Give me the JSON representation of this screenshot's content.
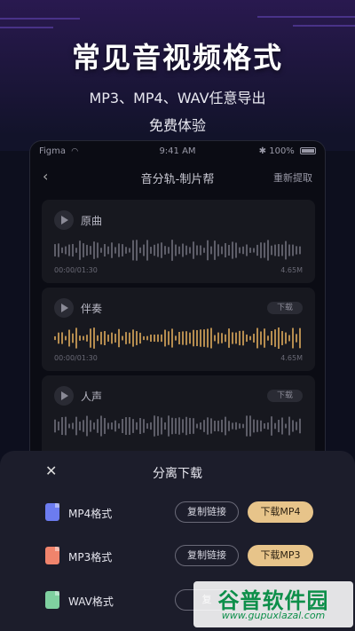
{
  "promo": {
    "headline": "常见音视频格式",
    "subline1": "MP3、MP4、WAV任意导出",
    "subline2": "免费体验"
  },
  "status_bar": {
    "carrier": "Figma",
    "time": "9:41 AM",
    "battery": "100%"
  },
  "nav": {
    "back_icon": "chevron-left-icon",
    "title": "音分轨-制片帮",
    "action": "重新提取"
  },
  "tracks": [
    {
      "name": "原曲",
      "download": "",
      "time": "00:00/01:30",
      "size": "4.65M",
      "wave_color": "#5d5d68"
    },
    {
      "name": "伴奏",
      "download": "下载",
      "time": "00:00/01:30",
      "size": "4.65M",
      "wave_color": "#b58c4f"
    },
    {
      "name": "人声",
      "download": "下载",
      "time": "",
      "size": "",
      "wave_color": "#5d5d68"
    }
  ],
  "sheet": {
    "title": "分离下载",
    "close_icon": "close-icon",
    "formats": [
      {
        "label": "MP4格式",
        "copy": "复制链接",
        "download": "下载MP4",
        "icon_color": "#6c7cf0"
      },
      {
        "label": "MP3格式",
        "copy": "复制链接",
        "download": "下载MP3",
        "icon_color": "#f0846c"
      },
      {
        "label": "WAV格式",
        "copy": "复",
        "download": "",
        "icon_color": "#7fd0a0"
      }
    ]
  },
  "watermark": {
    "brand": "谷普软件园",
    "url": "www.gupuxlazal.com"
  }
}
